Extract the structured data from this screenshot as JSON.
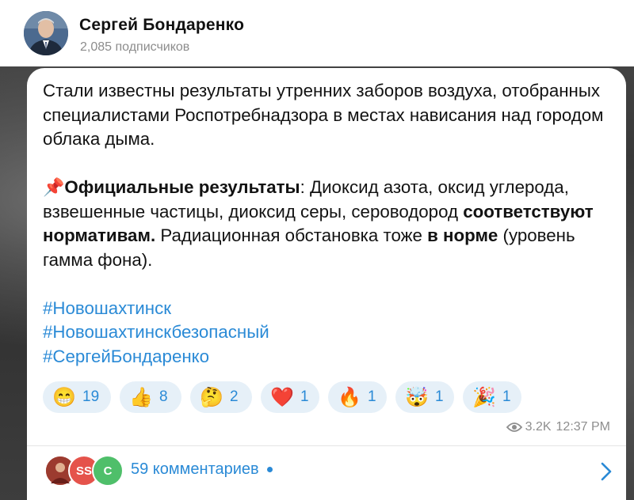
{
  "channel": {
    "name": "Сергей Бондаренко",
    "subscribers": "2,085 подписчиков"
  },
  "post": {
    "p1": "Стали известны результаты утренних заборов воздуха, отобранных специалистами Роспотребнадзора в местах нависания над городом облака дыма.",
    "pin_emoji": "📌",
    "results_bold": "Официальные результаты",
    "results_text": ": Диоксид азота, оксид углерода, взвешенные частицы, диоксид серы, сероводород ",
    "norm_bold": "соответствуют нормативам.",
    "radiation_text": " Радиационная обстановка тоже ",
    "in_norm_bold": "в норме",
    "gamma_text": " (уровень гамма фона).",
    "hashtags": [
      "#Новошахтинск",
      "#Новошахтинскбезопасный",
      "#СергейБондаренко"
    ]
  },
  "reactions": [
    {
      "emoji": "😁",
      "count": "19"
    },
    {
      "emoji": "👍",
      "count": "8"
    },
    {
      "emoji": "🤔",
      "count": "2"
    },
    {
      "emoji": "❤️",
      "count": "1"
    },
    {
      "emoji": "🔥",
      "count": "1"
    },
    {
      "emoji": "🤯",
      "count": "1"
    },
    {
      "emoji": "🎉",
      "count": "1"
    }
  ],
  "meta": {
    "views": "3.2K",
    "time": "12:37 PM"
  },
  "comments": {
    "label": "59 комментариев",
    "avatars": [
      {
        "text": "",
        "color": "#c0392b"
      },
      {
        "text": "SS",
        "color": "#e5534b"
      },
      {
        "text": "C",
        "color": "#4fbf6a"
      }
    ]
  },
  "icons": {
    "views": "eye-icon",
    "open": "chevron-right-icon"
  },
  "colors": {
    "accent": "#2a8ad6",
    "reaction_bg": "#e6f0f8"
  }
}
